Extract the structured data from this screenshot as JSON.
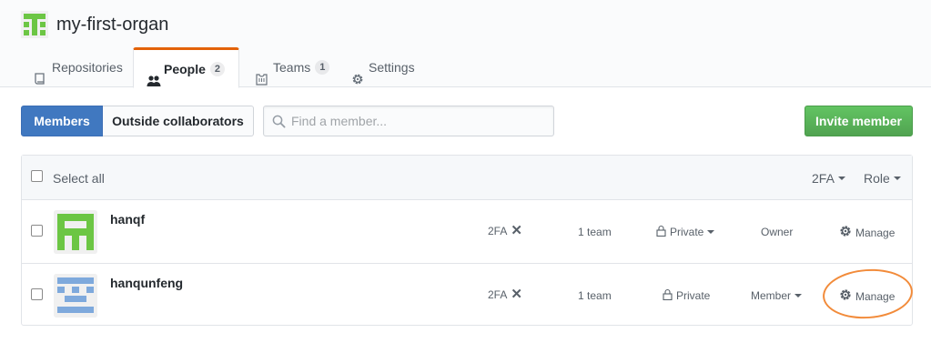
{
  "org": {
    "name": "my-first-organ",
    "avatar_icon": "identicon-green"
  },
  "tabs": [
    {
      "label": "Repositories",
      "icon": "repo-icon",
      "count": null
    },
    {
      "label": "People",
      "icon": "people-icon",
      "count": "2",
      "selected": true
    },
    {
      "label": "Teams",
      "icon": "jersey-icon",
      "count": "1"
    },
    {
      "label": "Settings",
      "icon": "gear-icon",
      "count": null
    }
  ],
  "filter": {
    "members_label": "Members",
    "outside_label": "Outside collaborators",
    "search_placeholder": "Find a member...",
    "invite_label": "Invite member"
  },
  "table": {
    "select_all_label": "Select all",
    "twofa_menu": "2FA",
    "role_menu": "Role",
    "members": [
      {
        "login": "hanqf",
        "avatar": "identicon-green",
        "twofa": "2FA",
        "twofa_status": "disabled",
        "teams": "1 team",
        "visibility": "Private",
        "visibility_dropdown": true,
        "role": "Owner",
        "role_dropdown": false,
        "manage_label": "Manage"
      },
      {
        "login": "hanqunfeng",
        "avatar": "identicon-blue",
        "twofa": "2FA",
        "twofa_status": "disabled",
        "teams": "1 team",
        "visibility": "Private",
        "visibility_dropdown": false,
        "role": "Member",
        "role_dropdown": true,
        "manage_label": "Manage"
      }
    ]
  },
  "colors": {
    "accent_tab": "#e36209",
    "selected_segment": "#4078c0",
    "invite_button": "#5cb85c",
    "annotation_circle": "#f28b3a",
    "identicon_green": "#6cc644",
    "identicon_blue": "#7ea9dc"
  }
}
